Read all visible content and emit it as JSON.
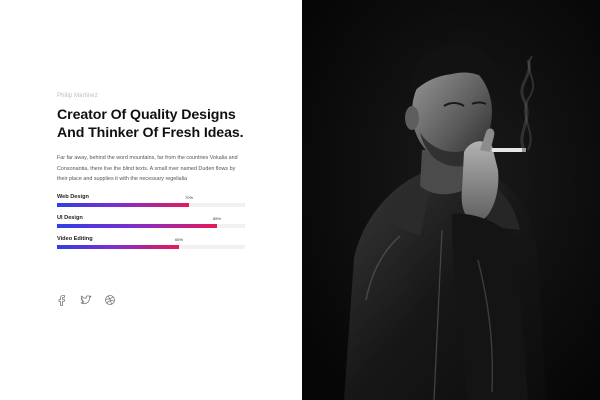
{
  "about": {
    "author": "Philip Martinez",
    "headline": "Creator Of Quality Designs\nAnd Thinker Of Fresh Ideas.",
    "description": "Far far away, behind the word mountains, far from the countries Vokalia and Consonantia, there live the blind texts. A small river named Duden flows by their place and supplies it with the necessary regelialia"
  },
  "skills": [
    {
      "label": "Web Design",
      "percent_label": "70%",
      "value": 0.7
    },
    {
      "label": "UI Design",
      "percent_label": "85%",
      "value": 0.85
    },
    {
      "label": "Video Editing",
      "percent_label": "65%",
      "value": 0.65
    }
  ],
  "social": [
    {
      "icon": "facebook-icon"
    },
    {
      "icon": "twitter-icon"
    },
    {
      "icon": "dribbble-icon"
    }
  ],
  "colors": {
    "bar_start": "#2f3fe4",
    "bar_end": "#e5195c",
    "track": "#f1f1f1",
    "photo_bg": "#0a0a0a"
  }
}
